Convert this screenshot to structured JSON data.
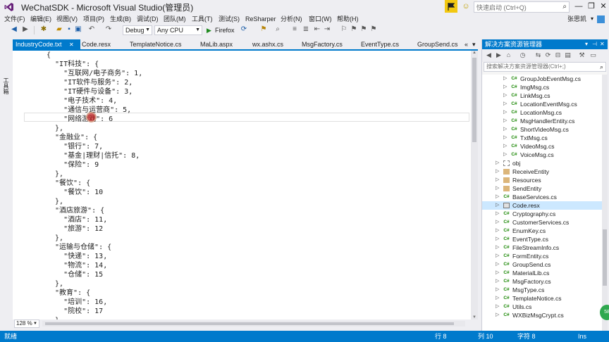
{
  "window": {
    "title": "WeChatSDK - Microsoft Visual Studio(管理员)",
    "quick_launch_placeholder": "快速启动 (Ctrl+Q)",
    "minimize": "—",
    "maximize": "❐",
    "close": "✕"
  },
  "menu": {
    "items": [
      "文件(F)",
      "编辑(E)",
      "视图(V)",
      "项目(P)",
      "生成(B)",
      "调试(D)",
      "团队(M)",
      "工具(T)",
      "测试(S)",
      "ReSharper",
      "分析(N)",
      "窗口(W)",
      "帮助(H)"
    ],
    "user": "张思凯",
    "user_arrow": "▾"
  },
  "toolbar": {
    "config": "Debug",
    "platform": "Any CPU",
    "run_label": "Firefox",
    "run_icon": "▶"
  },
  "left_strip": {
    "toolbox": "工具箱"
  },
  "tabs": {
    "items": [
      "IndustryCode.txt",
      "Code.resx",
      "TemplateNotice.cs",
      "MaLib.aspx",
      "wx.ashx.cs",
      "MsgFactory.cs",
      "EventType.cs",
      "GroupSend.cs"
    ],
    "active_index": 0,
    "close_glyph": "✕",
    "scroll_left": "«",
    "scroll_right": "▾"
  },
  "editor": {
    "lines": [
      "{",
      "  \"IT科技\": {",
      "    \"互联网/电子商务\": 1,",
      "    \"IT软件与服务\": 2,",
      "    \"IT硬件与设备\": 3,",
      "    \"电子技术\": 4,",
      "    \"通信与运营商\": 5,",
      "    \"网络游戏\": 6",
      "  },",
      "  \"金融业\": {",
      "    \"银行\": 7,",
      "    \"基金|理财|信托\": 8,",
      "    \"保险\": 9",
      "  },",
      "  \"餐饮\": {",
      "    \"餐饮\": 10",
      "  },",
      "  \"酒店旅游\": {",
      "    \"酒店\": 11,",
      "    \"旅游\": 12",
      "  },",
      "  \"运输与仓储\": {",
      "    \"快递\": 13,",
      "    \"物流\": 14,",
      "    \"仓储\": 15",
      "  },",
      "  \"教育\": {",
      "    \"培训\": 16,",
      "    \"院校\": 17",
      "  }"
    ],
    "zoom": "128 %"
  },
  "solution_explorer": {
    "title": "解决方案资源管理器",
    "search_placeholder": "搜索解决方案资源管理器(Ctrl+;)",
    "pin": "▾",
    "pin2": "⊣",
    "close": "✕",
    "items": [
      {
        "label": "GroupJobEventMsg.cs",
        "icon": "C#",
        "type": "cs",
        "depth": 2
      },
      {
        "label": "ImgMsg.cs",
        "icon": "C#",
        "type": "cs",
        "depth": 2
      },
      {
        "label": "LinkMsg.cs",
        "icon": "C#",
        "type": "cs",
        "depth": 2
      },
      {
        "label": "LocationEventMsg.cs",
        "icon": "C#",
        "type": "cs",
        "depth": 2
      },
      {
        "label": "LocationMsg.cs",
        "icon": "C#",
        "type": "cs",
        "depth": 2
      },
      {
        "label": "MsgHandlerEntity.cs",
        "icon": "C#",
        "type": "cs",
        "depth": 2
      },
      {
        "label": "ShortVideoMsg.cs",
        "icon": "C#",
        "type": "cs",
        "depth": 2
      },
      {
        "label": "TxtMsg.cs",
        "icon": "C#",
        "type": "cs",
        "depth": 2
      },
      {
        "label": "VideoMsg.cs",
        "icon": "C#",
        "type": "cs",
        "depth": 2
      },
      {
        "label": "VoiceMsg.cs",
        "icon": "C#",
        "type": "cs",
        "depth": 2
      },
      {
        "label": "obj",
        "icon": "",
        "type": "obj",
        "depth": 1
      },
      {
        "label": "ReceiveEntity",
        "icon": "",
        "type": "folder",
        "depth": 1
      },
      {
        "label": "Resources",
        "icon": "",
        "type": "folder",
        "depth": 1
      },
      {
        "label": "SendEntity",
        "icon": "",
        "type": "folder",
        "depth": 1
      },
      {
        "label": "BaseServices.cs",
        "icon": "C#",
        "type": "cs",
        "depth": 1
      },
      {
        "label": "Code.resx",
        "icon": "",
        "type": "resx",
        "depth": 1,
        "selected": true
      },
      {
        "label": "Cryptography.cs",
        "icon": "C#",
        "type": "cs",
        "depth": 1
      },
      {
        "label": "CustomerServices.cs",
        "icon": "C#",
        "type": "cs",
        "depth": 1
      },
      {
        "label": "EnumKey.cs",
        "icon": "C#",
        "type": "cs",
        "depth": 1
      },
      {
        "label": "EventType.cs",
        "icon": "C#",
        "type": "cs",
        "depth": 1
      },
      {
        "label": "FileStreamInfo.cs",
        "icon": "C#",
        "type": "cs",
        "depth": 1
      },
      {
        "label": "FormEntity.cs",
        "icon": "C#",
        "type": "cs",
        "depth": 1
      },
      {
        "label": "GroupSend.cs",
        "icon": "C#",
        "type": "cs",
        "depth": 1
      },
      {
        "label": "MaterialLib.cs",
        "icon": "C#",
        "type": "cs",
        "depth": 1
      },
      {
        "label": "MsgFactory.cs",
        "icon": "C#",
        "type": "cs",
        "depth": 1
      },
      {
        "label": "MsgType.cs",
        "icon": "C#",
        "type": "cs",
        "depth": 1
      },
      {
        "label": "TemplateNotice.cs",
        "icon": "C#",
        "type": "cs",
        "depth": 1
      },
      {
        "label": "Utils.cs",
        "icon": "C#",
        "type": "cs",
        "depth": 1
      },
      {
        "label": "WXBizMsgCrypt.cs",
        "icon": "C#",
        "type": "cs",
        "depth": 1
      }
    ]
  },
  "status": {
    "ready": "就绪",
    "line": "行 8",
    "column": "列 10",
    "char": "字符 8",
    "mode": "Ins"
  },
  "colors": {
    "accent": "#007acc",
    "chrome": "#eeeef2",
    "editor_bg": "#ffffff",
    "selection": "#cce8ff"
  }
}
